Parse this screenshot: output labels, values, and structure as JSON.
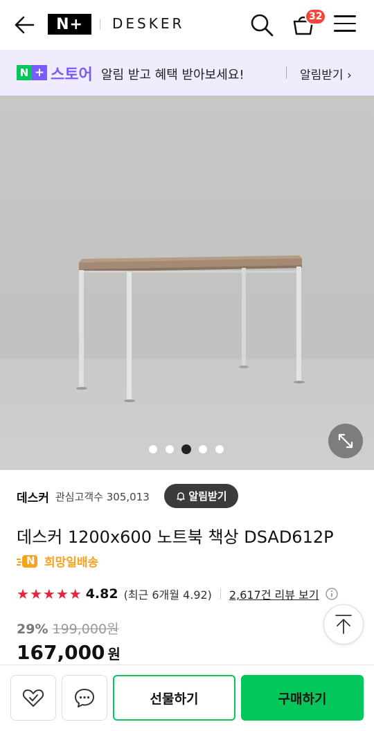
{
  "header": {
    "logo_text": "N+",
    "brand": "DESKER",
    "cart_count": "32"
  },
  "banner": {
    "npay_n": "N",
    "npay_plus": "+",
    "store_label": "스토어",
    "message": "알림 받고 혜택 받아보세요!",
    "link_label": "알림받기 ›"
  },
  "gallery": {
    "total_images": 5,
    "active_index": 2
  },
  "product": {
    "seller": "데스커",
    "interest_label": "관심고객수 305,013",
    "alarm_button": "알림받기",
    "title": "데스커 1200x600 노트북 책상 DSAD612P",
    "delivery_badge": "N",
    "delivery_label": "희망일배송",
    "rating_stars": 5,
    "rating_score": "4.82",
    "recent_rating": "(최근 6개월 4.92)",
    "review_link": "2,617건 리뷰 보기",
    "discount": "29%",
    "original_price": "199,000원",
    "price": "167,000",
    "currency": "원"
  },
  "actions": {
    "gift_label": "선물하기",
    "buy_label": "구매하기"
  },
  "colors": {
    "naver_green": "#03c75a",
    "store_purple": "#7a5af8",
    "badge_red": "#f0463c",
    "star_red": "#e8243c",
    "delivery_orange": "#f6a21e"
  }
}
